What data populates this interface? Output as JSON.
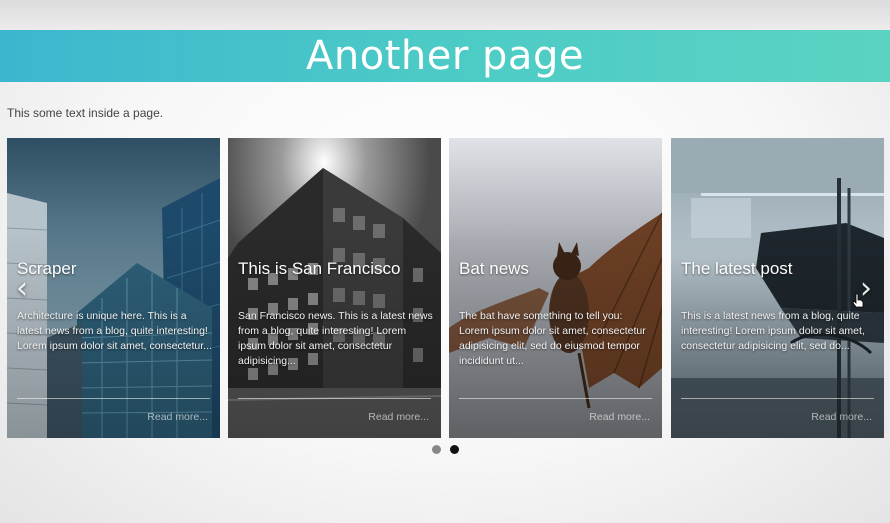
{
  "page": {
    "title": "Another page",
    "intro": "This some text inside a page."
  },
  "slider": {
    "prev_icon": "chevron-left-icon",
    "next_icon": "chevron-right-icon",
    "cards": [
      {
        "title": "Scraper",
        "excerpt": "Architecture is unique here. This is a latest news from a blog, quite interesting! Lorem ipsum dolor sit amet, consectetur...",
        "read_more": "Read more..."
      },
      {
        "title": "This is San Francisco",
        "excerpt": "San Francisco news. This is a latest news from a blog, quite interesting! Lorem ipsum dolor sit amet, consectetur adipisicing...",
        "read_more": "Read more..."
      },
      {
        "title": "Bat news",
        "excerpt": "The bat have something to tell you: Lorem ipsum dolor sit amet, consectetur adipisicing elit, sed do eiusmod tempor incididunt ut...",
        "read_more": "Read more..."
      },
      {
        "title": "The latest post",
        "excerpt": "This is a latest news from a blog, quite interesting! Lorem ipsum dolor sit amet, consectetur adipisicing elit, sed do...",
        "read_more": "Read more..."
      }
    ],
    "pagination": {
      "pages": 2,
      "active": 2
    }
  },
  "colors": {
    "banner_start": "#3cb6cf",
    "banner_end": "#5ad3c2",
    "dot_inactive": "#888888",
    "dot_active": "#111111"
  }
}
